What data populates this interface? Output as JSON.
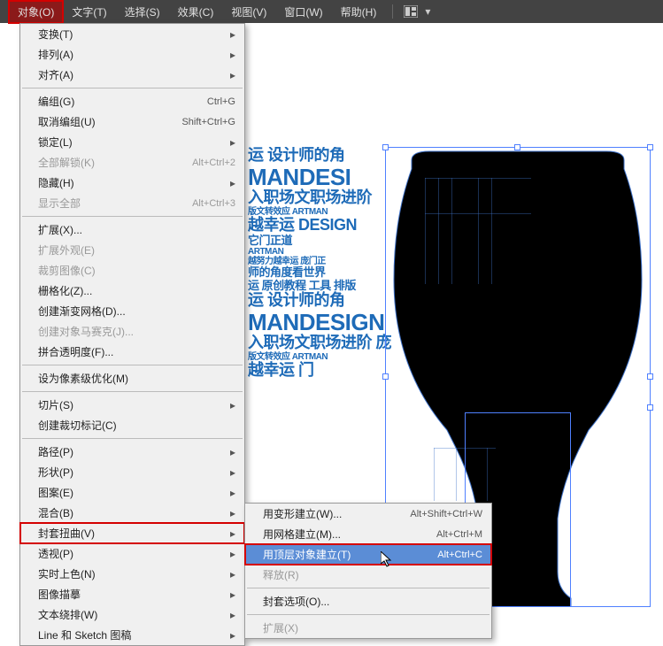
{
  "menubar": {
    "items": [
      {
        "label": "对象(O)",
        "active": true
      },
      {
        "label": "文字(T)"
      },
      {
        "label": "选择(S)"
      },
      {
        "label": "效果(C)"
      },
      {
        "label": "视图(V)"
      },
      {
        "label": "窗口(W)"
      },
      {
        "label": "帮助(H)"
      }
    ]
  },
  "object_menu": [
    {
      "label": "变换(T)",
      "arrow": true
    },
    {
      "label": "排列(A)",
      "arrow": true
    },
    {
      "label": "对齐(A)",
      "arrow": true
    },
    {
      "sep": true
    },
    {
      "label": "编组(G)",
      "shortcut": "Ctrl+G"
    },
    {
      "label": "取消编组(U)",
      "shortcut": "Shift+Ctrl+G"
    },
    {
      "label": "锁定(L)",
      "arrow": true
    },
    {
      "label": "全部解锁(K)",
      "shortcut": "Alt+Ctrl+2",
      "disabled": true
    },
    {
      "label": "隐藏(H)",
      "arrow": true
    },
    {
      "label": "显示全部",
      "shortcut": "Alt+Ctrl+3",
      "disabled": true
    },
    {
      "sep": true
    },
    {
      "label": "扩展(X)..."
    },
    {
      "label": "扩展外观(E)",
      "disabled": true
    },
    {
      "label": "裁剪图像(C)",
      "disabled": true
    },
    {
      "label": "栅格化(Z)..."
    },
    {
      "label": "创建渐变网格(D)..."
    },
    {
      "label": "创建对象马赛克(J)...",
      "disabled": true
    },
    {
      "label": "拼合透明度(F)..."
    },
    {
      "sep": true
    },
    {
      "label": "设为像素级优化(M)"
    },
    {
      "sep": true
    },
    {
      "label": "切片(S)",
      "arrow": true
    },
    {
      "label": "创建裁切标记(C)"
    },
    {
      "sep": true
    },
    {
      "label": "路径(P)",
      "arrow": true
    },
    {
      "label": "形状(P)",
      "arrow": true
    },
    {
      "label": "图案(E)",
      "arrow": true
    },
    {
      "label": "混合(B)",
      "arrow": true
    },
    {
      "label": "封套扭曲(V)",
      "arrow": true,
      "highlight": true
    },
    {
      "label": "透视(P)",
      "arrow": true
    },
    {
      "label": "实时上色(N)",
      "arrow": true
    },
    {
      "label": "图像描摹",
      "arrow": true
    },
    {
      "label": "文本绕排(W)",
      "arrow": true
    },
    {
      "label": "Line 和 Sketch 图稿",
      "arrow": true
    }
  ],
  "envelope_submenu": [
    {
      "label": "用变形建立(W)...",
      "shortcut": "Alt+Shift+Ctrl+W"
    },
    {
      "label": "用网格建立(M)...",
      "shortcut": "Alt+Ctrl+M"
    },
    {
      "label": "用顶层对象建立(T)",
      "shortcut": "Alt+Ctrl+C",
      "highlight": true
    },
    {
      "label": "释放(R)",
      "disabled": true
    },
    {
      "sep": true
    },
    {
      "label": "封套选项(O)..."
    },
    {
      "sep": true
    },
    {
      "label": "扩展(X)",
      "disabled": true
    }
  ],
  "canvas": {
    "text_lines_top": [
      {
        "t": "运 设计师的角",
        "cls": "t-med"
      },
      {
        "t": "MANDESI",
        "cls": "t-big"
      },
      {
        "t": "入职场文职场进阶",
        "cls": "t-med"
      },
      {
        "t": "版文转效应 ARTMAN",
        "cls": "t-xs"
      },
      {
        "t": "越幸运 DESIGN",
        "cls": "t-med"
      },
      {
        "t": "它门正道",
        "cls": "t-sm"
      },
      {
        "t": "ARTMAN",
        "cls": "t-xs"
      },
      {
        "t": "越努力越幸运 庞门正",
        "cls": "t-xs"
      },
      {
        "t": "师的角度看世界",
        "cls": "t-sm"
      },
      {
        "t": "运 原创教程 工具 排版",
        "cls": "t-sm"
      },
      {
        "t": "运 设计师的角",
        "cls": "t-med"
      },
      {
        "t": "MANDESIGN",
        "cls": "t-big"
      },
      {
        "t": "入职场文职场进阶 庞",
        "cls": "t-med"
      },
      {
        "t": "版文转效应 ARTMAN",
        "cls": "t-xs"
      },
      {
        "t": "越幸运 门",
        "cls": "t-med"
      }
    ]
  }
}
